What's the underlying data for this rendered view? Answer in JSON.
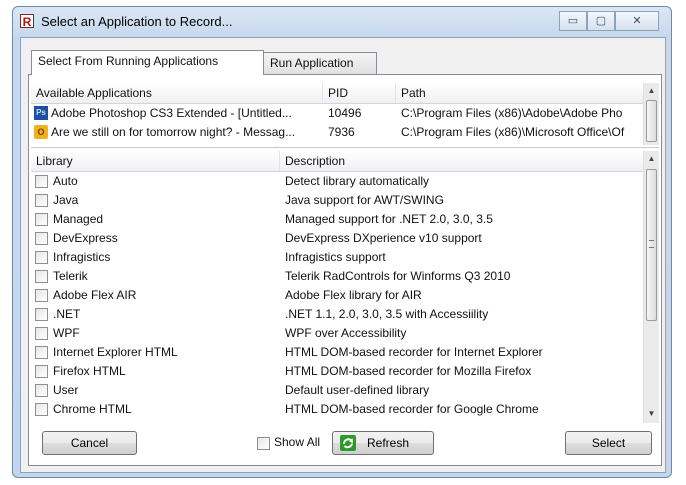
{
  "window": {
    "title": "Select an Application to Record...",
    "app_icon_letter": "R",
    "minimize_glyph": "▭",
    "maximize_glyph": "▢",
    "close_glyph": "✕"
  },
  "tabs": [
    {
      "label": "Select From Running Applications"
    },
    {
      "label": "Run Application"
    }
  ],
  "apps_table": {
    "headers": {
      "name": "Available Applications",
      "pid": "PID",
      "path": "Path"
    },
    "rows": [
      {
        "icon": "photoshop-icon",
        "icon_text": "Ps",
        "name": "Adobe Photoshop CS3 Extended - [Untitled...",
        "pid": "10496",
        "path": "C:\\Program Files (x86)\\Adobe\\Adobe Pho"
      },
      {
        "icon": "outlook-icon",
        "icon_text": "O",
        "name": "Are we still on for tomorrow night? - Messag...",
        "pid": "7936",
        "path": "C:\\Program Files (x86)\\Microsoft Office\\Of"
      }
    ]
  },
  "library_table": {
    "headers": {
      "library": "Library",
      "description": "Description"
    },
    "rows": [
      {
        "library": "Auto",
        "description": "Detect library automatically"
      },
      {
        "library": "Java",
        "description": "Java support for AWT/SWING"
      },
      {
        "library": "Managed",
        "description": "Managed support for .NET 2.0, 3.0, 3.5"
      },
      {
        "library": "DevExpress",
        "description": "DevExpress DXperience v10 support"
      },
      {
        "library": "Infragistics",
        "description": "Infragistics support"
      },
      {
        "library": "Telerik",
        "description": "Telerik RadControls for Winforms Q3 2010"
      },
      {
        "library": "Adobe Flex AIR",
        "description": "Adobe Flex library for AIR"
      },
      {
        "library": ".NET",
        "description": ".NET 1.1, 2.0, 3.0, 3.5 with Accessiility"
      },
      {
        "library": "WPF",
        "description": "WPF over Accessibility"
      },
      {
        "library": "Internet Explorer HTML",
        "description": "HTML DOM-based recorder for Internet Explorer"
      },
      {
        "library": "Firefox HTML",
        "description": "HTML DOM-based recorder for Mozilla Firefox"
      },
      {
        "library": "User",
        "description": "Default user-defined library"
      },
      {
        "library": "Chrome HTML",
        "description": "HTML DOM-based recorder for Google Chrome"
      }
    ]
  },
  "footer": {
    "cancel_label": "Cancel",
    "show_all_label": "Show All",
    "refresh_label": "Refresh",
    "select_label": "Select"
  },
  "colors": {
    "window_frame": "#c4d6ed",
    "refresh_icon": "#2e9a2e",
    "photoshop_icon": "#1f4fa0",
    "outlook_icon": "#f2b01e"
  }
}
